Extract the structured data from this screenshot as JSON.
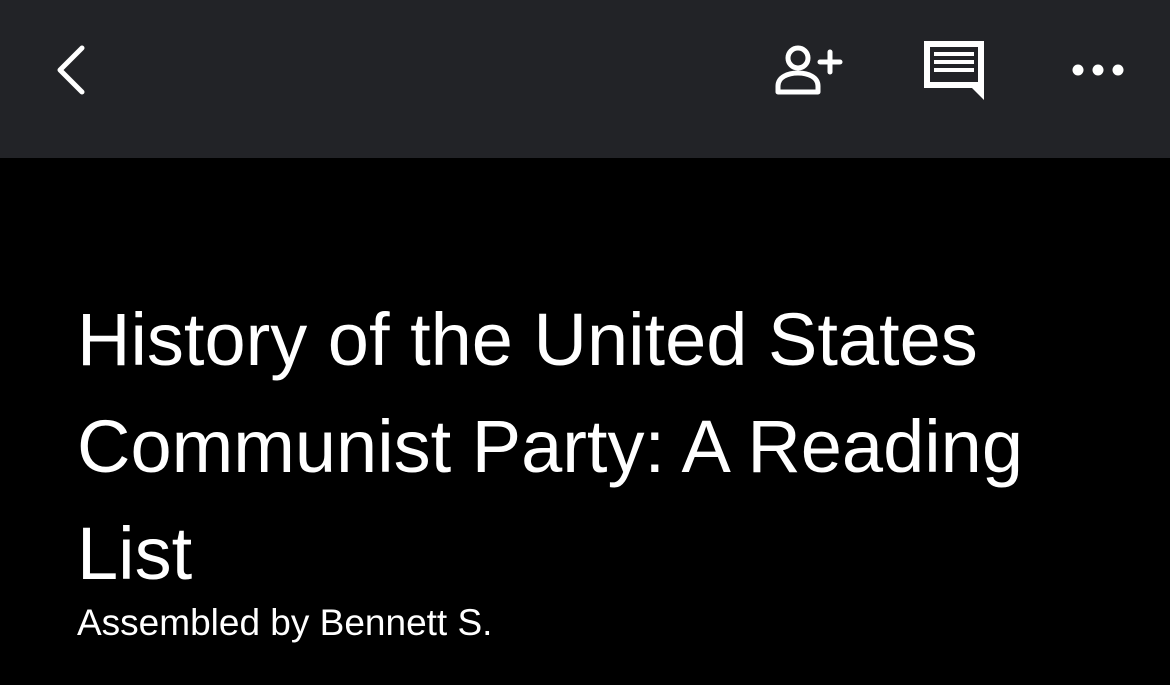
{
  "toolbar": {
    "background": "#222327",
    "icons": {
      "back": "chevron-left-icon",
      "add_person": "person-add-icon",
      "comments": "comment-icon",
      "more": "more-horizontal-icon"
    },
    "icon_color": "#ffffff"
  },
  "document": {
    "title": "History of the United States Communist Party: A Reading List",
    "subtitle": "Assembled by Bennett S.",
    "background": "#000000",
    "text_color": "#ffffff"
  }
}
